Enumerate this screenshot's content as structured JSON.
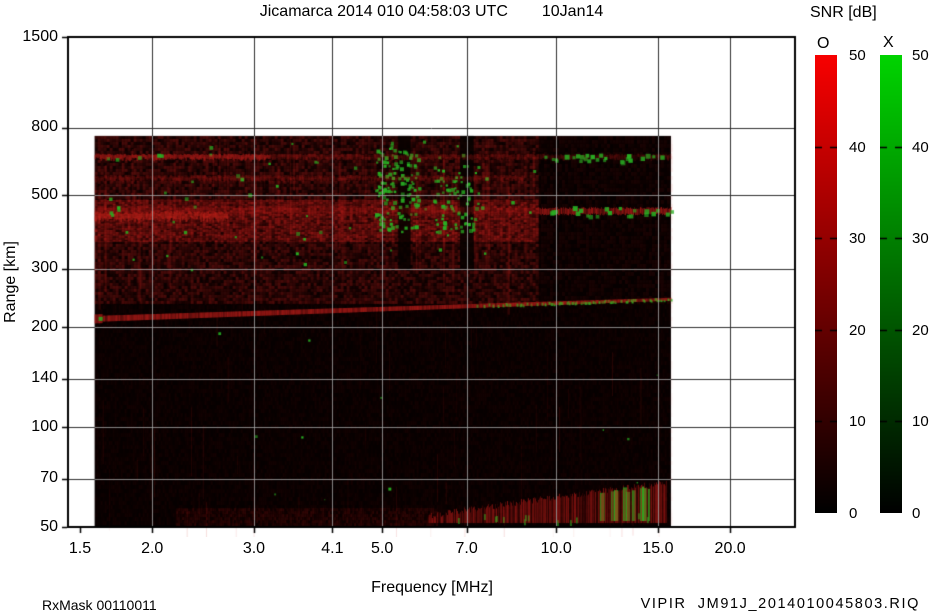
{
  "title": {
    "main": "Jicamarca 2014 010 04:58:03 UTC",
    "date": "10Jan14"
  },
  "footer": {
    "rx_mask": "RxMask 00110011",
    "file": "VIPIR  JM91J_2014010045803.RIQ"
  },
  "colors": {
    "o_mode_top": "#f80000",
    "x_mode_top": "#00d400",
    "data_background": "#060100",
    "grid_outside": "#2e2e2e",
    "grid_inside": "rgba(165,165,165,0.8)",
    "echo_red": "200,32,28",
    "echo_green": "40,175,35"
  },
  "chart_data": {
    "type": "heatmap",
    "title": "Jicamarca 2014 010 04:58:03 UTC  10Jan14",
    "xlabel": "Frequency [MHz]",
    "ylabel": "Range [km]",
    "x_scale": "log",
    "y_scale": "log",
    "xlim": [
      1.43,
      25.9
    ],
    "ylim": [
      50,
      1500
    ],
    "x_ticks": [
      1.5,
      2.0,
      3.0,
      4.1,
      5.0,
      7.0,
      10.0,
      15.0,
      20.0
    ],
    "x_tick_labels": [
      "1.5",
      "2.0",
      "3.0",
      "4.1",
      "5.0",
      "7.0",
      "10.0",
      "15.0",
      "20.0"
    ],
    "y_ticks": [
      50,
      70,
      100,
      140,
      200,
      300,
      500,
      800,
      1500
    ],
    "y_tick_labels": [
      "50",
      "70",
      "100",
      "140",
      "200",
      "300",
      "500",
      "800",
      "1500"
    ],
    "grid": true,
    "colorbar_title": "SNR [dB]",
    "colorbars": [
      {
        "mode": "O",
        "min": 0,
        "max": 50,
        "ticks": [
          0,
          10,
          20,
          30,
          40,
          50
        ],
        "tick_labels": [
          "0",
          "10",
          "20",
          "30",
          "40",
          "50"
        ]
      },
      {
        "mode": "X",
        "min": 0,
        "max": 50,
        "ticks": [
          0,
          10,
          20,
          30,
          40,
          50
        ],
        "tick_labels": [
          "0",
          "10",
          "20",
          "30",
          "40",
          "50"
        ]
      }
    ],
    "features": {
      "data_extent": {
        "freq": [
          1.59,
          15.8
        ],
        "range": [
          50,
          755
        ]
      },
      "diffuse_spread_f": {
        "freq": [
          1.59,
          9.3
        ],
        "range": [
          240,
          755
        ]
      },
      "diffuse_dim_right": {
        "freq": [
          9.3,
          15.8
        ],
        "range": [
          240,
          755
        ]
      },
      "bright_band": {
        "freq": [
          1.59,
          9.3
        ],
        "range": [
          366,
          484
        ]
      },
      "band_edge_line": {
        "freq": [
          1.59,
          2.7
        ],
        "range": [
          428,
          448
        ]
      },
      "absorption_notches_mhz": [
        [
          5.33,
          5.6
        ],
        [
          6.82,
          7.2
        ]
      ],
      "green_clusters": [
        {
          "freq": [
            4.85,
            5.75
          ],
          "range": [
            390,
            700
          ],
          "count": 130
        },
        {
          "freq": [
            6.1,
            7.35
          ],
          "range": [
            380,
            620
          ],
          "count": 75
        },
        {
          "freq": [
            1.6,
            9.3
          ],
          "range": [
            300,
            760
          ],
          "count": 55
        }
      ],
      "interference_lines": [
        {
          "range": [
            640,
            668
          ],
          "freq": [
            1.59,
            15.8
          ],
          "bright_freq": [
            1.59,
            3.2
          ],
          "green_freq": [
            9.5,
            15.8
          ],
          "green_count": 26
        },
        {
          "range": [
            552,
            575
          ],
          "freq": [
            1.59,
            8.8
          ]
        },
        {
          "range": [
            438,
            464
          ],
          "freq": [
            1.59,
            9.3
          ],
          "bright_freq": [
            9.3,
            15.8
          ],
          "green_freq": [
            9.4,
            15.8
          ],
          "green_count": 22
        }
      ],
      "e_region_trace": {
        "freq": [
          1.59,
          15.8
        ],
        "range": [
          212,
          243
        ],
        "green_from_mhz": 7.2
      },
      "bottom_wedge": {
        "freq": [
          6.0,
          15.5
        ],
        "range_top": [
          54,
          68
        ],
        "green_freq": [
          11.3,
          15.3
        ]
      },
      "bottom_noise": {
        "freq": [
          2.2,
          6.2
        ],
        "range": [
          50,
          57
        ]
      }
    }
  }
}
